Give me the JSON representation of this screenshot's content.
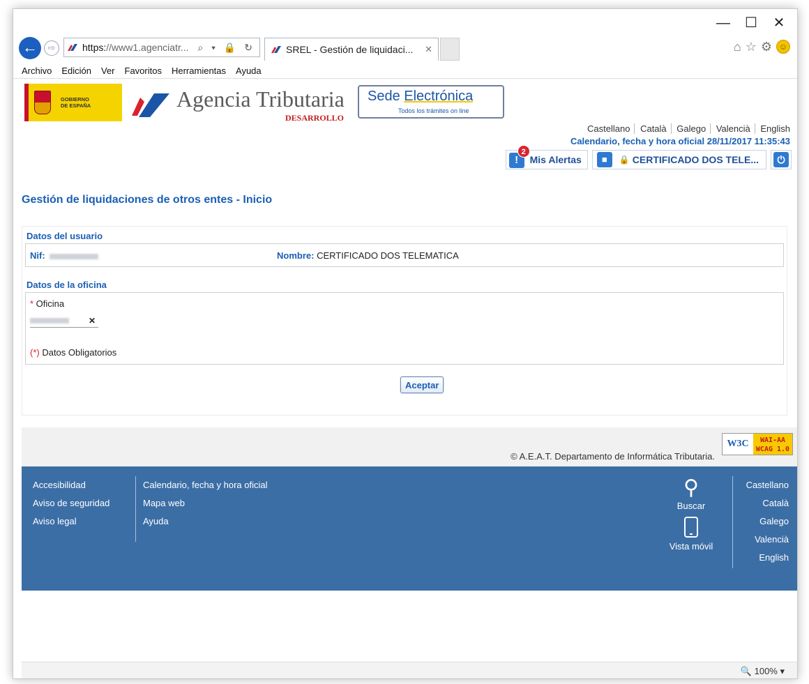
{
  "browser": {
    "caption_buttons": {
      "minimize": "—",
      "maximize": "☐",
      "close": "✕"
    },
    "address": {
      "https": "https:",
      "rest": "//www1.agenciatr...",
      "tools": "⌕ ▾ 🔒 ↻"
    },
    "tab": {
      "title": "SREL - Gestión de liquidaci...",
      "close": "✕"
    },
    "menu": [
      "Archivo",
      "Edición",
      "Ver",
      "Favoritos",
      "Herramientas",
      "Ayuda"
    ],
    "status": {
      "zoom": "🔍 100%  ▾"
    }
  },
  "header": {
    "gobierno": "GOBIERNO\nDE ESPAÑA",
    "agency_name": "Agencia Tributaria",
    "environment": "DESARROLLO",
    "sede_title_1": "Sede ",
    "sede_title_2": "Electrónica",
    "sede_subtitle": "Todos los trámites on line",
    "languages": [
      "Castellano",
      "Català",
      "Galego",
      "Valencià",
      "English"
    ],
    "calendar": "Calendario, fecha y hora oficial 28/11/2017 11:35:43",
    "alerts_label": "Mis Alertas",
    "alerts_count": "2",
    "certificate_label": "CERTIFICADO DOS TELE..."
  },
  "main": {
    "page_title": "Gestión de liquidaciones de otros entes - Inicio",
    "user_section": "Datos del usuario",
    "nif_label": "Nif:",
    "name_label": "Nombre:",
    "name_value": "CERTIFICADO DOS TELEMATICA",
    "office_section": "Datos de la oficina",
    "office_required_mark": "*",
    "office_label": " Oficina",
    "clear_button": "✕",
    "mandatory_mark": "(*)",
    "mandatory_note": " Datos Obligatorios",
    "accept_button": "Aceptar"
  },
  "footer": {
    "copyright": "© A.E.A.T. Departamento de Informática Tributaria.",
    "w3c_left": "W3C",
    "wai_line1": "WAI-AA",
    "wai_line2": "WCAG 1.0",
    "col1": [
      "Accesibilidad",
      "Aviso de seguridad",
      "Aviso legal"
    ],
    "col2": [
      "Calendario, fecha y hora oficial",
      "Mapa web",
      "Ayuda"
    ],
    "search_label": "Buscar",
    "mobile_label": "Vista móvil",
    "languages": [
      "Castellano",
      "Català",
      "Galego",
      "Valencià",
      "English"
    ]
  },
  "colors": {
    "brand_blue": "#1a5fb4",
    "footer_blue": "#3c6ea6",
    "required_red": "#d9232d"
  }
}
